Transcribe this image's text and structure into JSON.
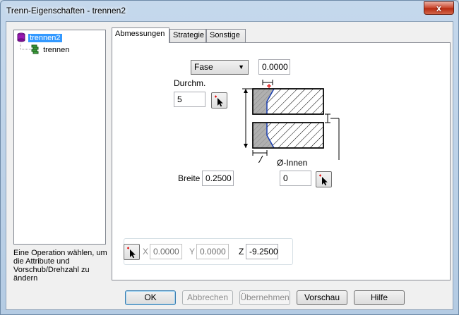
{
  "window": {
    "title": "Trenn-Eigenschaften - trennen2",
    "close_glyph": "x"
  },
  "tree": {
    "items": [
      {
        "label": "trennen2",
        "icon": "cylinder-icon",
        "selected": true
      },
      {
        "label": "trennen",
        "icon": "parting-tool-icon",
        "selected": false
      }
    ]
  },
  "hint_text": "Eine Operation wählen, um die Attribute und Vorschub/Drehzahl zu ändern",
  "tabs": [
    {
      "label": "Abmessungen",
      "active": true
    },
    {
      "label": "Strategie",
      "active": false
    },
    {
      "label": "Sonstige",
      "active": false
    }
  ],
  "dimensions": {
    "shape_select": "Fase",
    "chamfer_value": "0.0000",
    "diameter_label": "Durchm.",
    "diameter_value": "5",
    "width_label": "Breite",
    "width_value": "0.2500",
    "inner_label": "Ø-Innen",
    "inner_value": "0"
  },
  "coords": {
    "x_label": "X",
    "x_value": "0.0000",
    "y_label": "Y",
    "y_value": "0.0000",
    "z_label": "Z",
    "z_value": "-9.2500"
  },
  "buttons": {
    "ok": "OK",
    "cancel": "Abbrechen",
    "apply": "Übernehmen",
    "preview": "Vorschau",
    "help": "Hilfe"
  },
  "colors": {
    "selection": "#3399ff",
    "close_button": "#c8432a",
    "diagram_fill": "#b0b0b0",
    "diagram_outline": "#1a3fb0",
    "pick_marker": "#e00000"
  }
}
